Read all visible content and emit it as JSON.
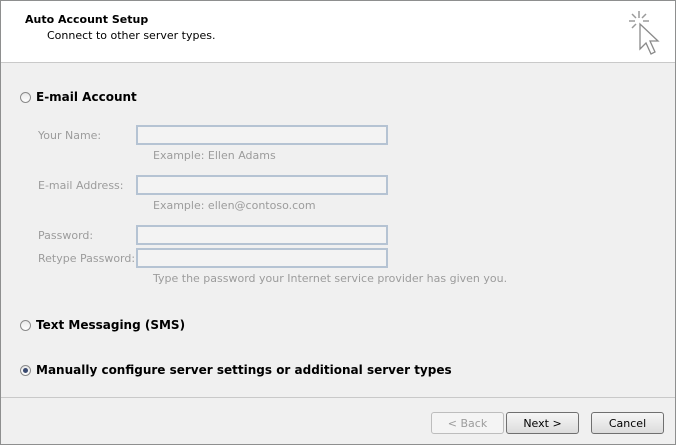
{
  "header": {
    "title": "Auto Account Setup",
    "subtitle": "Connect to other server types.",
    "icon": "wizard-cursor-icon"
  },
  "options": {
    "email": {
      "label": "E-mail Account",
      "checked": false
    },
    "sms": {
      "label": "Text Messaging (SMS)",
      "checked": false
    },
    "manual": {
      "label": "Manually configure server settings or additional server types",
      "checked": true
    }
  },
  "fields": {
    "your_name": {
      "label": "Your Name:",
      "value": "",
      "hint": "Example: Ellen Adams"
    },
    "email_address": {
      "label": "E-mail Address:",
      "value": "",
      "hint": "Example: ellen@contoso.com"
    },
    "password": {
      "label": "Password:",
      "value": ""
    },
    "retype_password": {
      "label": "Retype Password:",
      "value": ""
    },
    "password_hint": "Type the password your Internet service provider has given you."
  },
  "buttons": {
    "back": "< Back",
    "next": "Next >",
    "cancel": "Cancel"
  }
}
